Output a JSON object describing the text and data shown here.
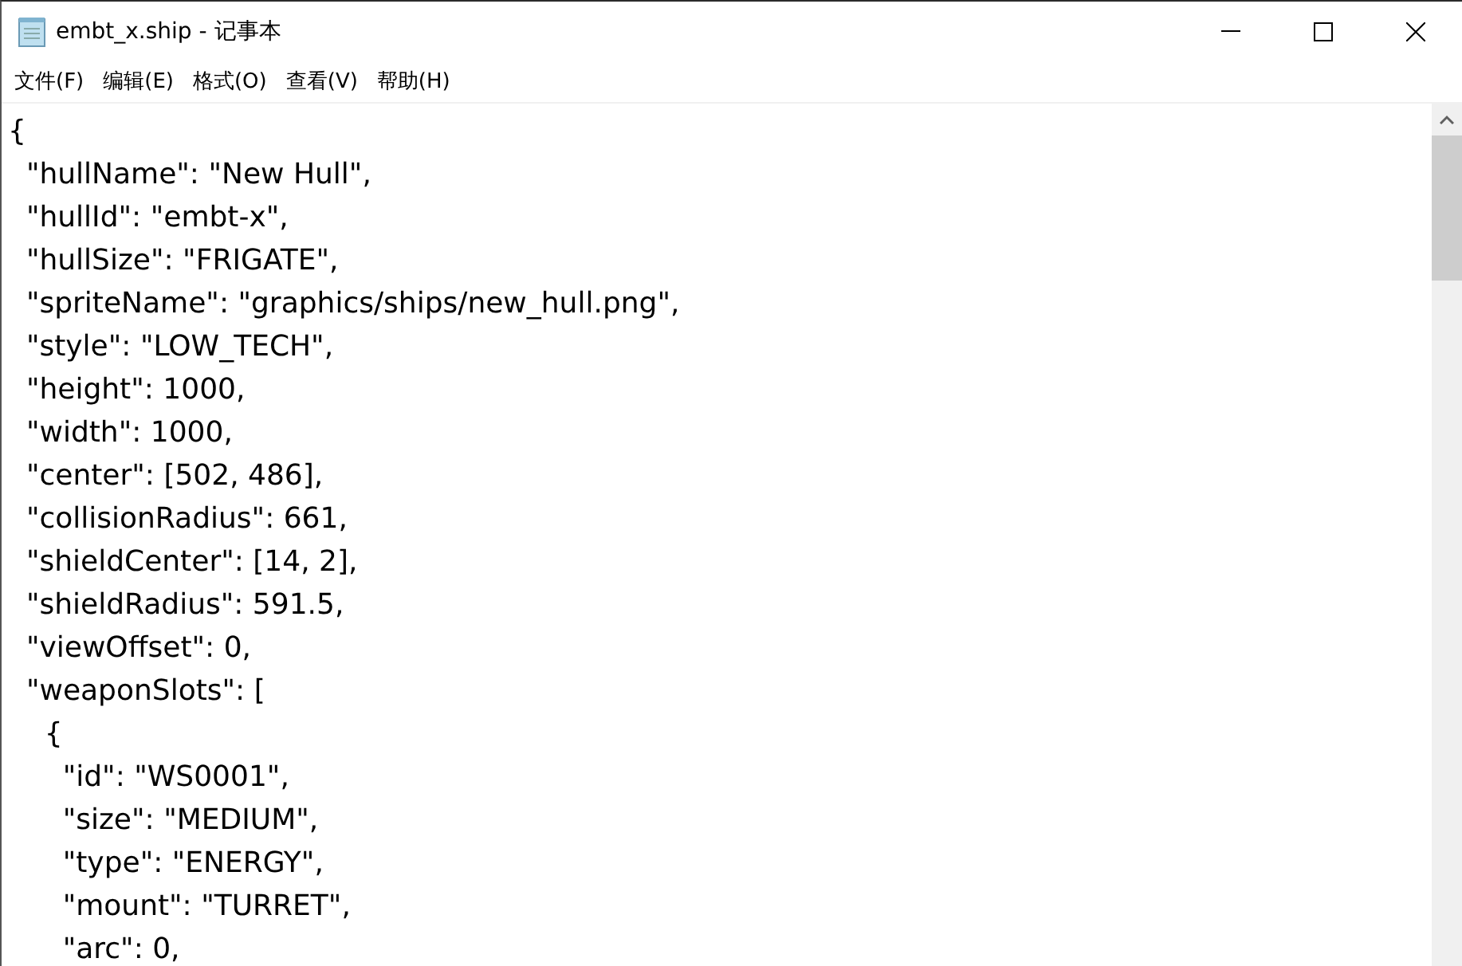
{
  "window": {
    "title": "embt_x.ship - 记事本"
  },
  "menu": [
    "文件(F)",
    "编辑(E)",
    "格式(O)",
    "查看(V)",
    "帮助(H)"
  ],
  "editor": {
    "lines": [
      "{",
      "  \"hullName\": \"New Hull\",",
      "  \"hullId\": \"embt-x\",",
      "  \"hullSize\": \"FRIGATE\",",
      "  \"spriteName\": \"graphics/ships/new_hull.png\",",
      "  \"style\": \"LOW_TECH\",",
      "  \"height\": 1000,",
      "  \"width\": 1000,",
      "  \"center\": [502, 486],",
      "  \"collisionRadius\": 661,",
      "  \"shieldCenter\": [14, 2],",
      "  \"shieldRadius\": 591.5,",
      "  \"viewOffset\": 0,",
      "  \"weaponSlots\": [",
      "    {",
      "      \"id\": \"WS0001\",",
      "      \"size\": \"MEDIUM\",",
      "      \"type\": \"ENERGY\",",
      "      \"mount\": \"TURRET\",",
      "      \"arc\": 0,"
    ]
  }
}
